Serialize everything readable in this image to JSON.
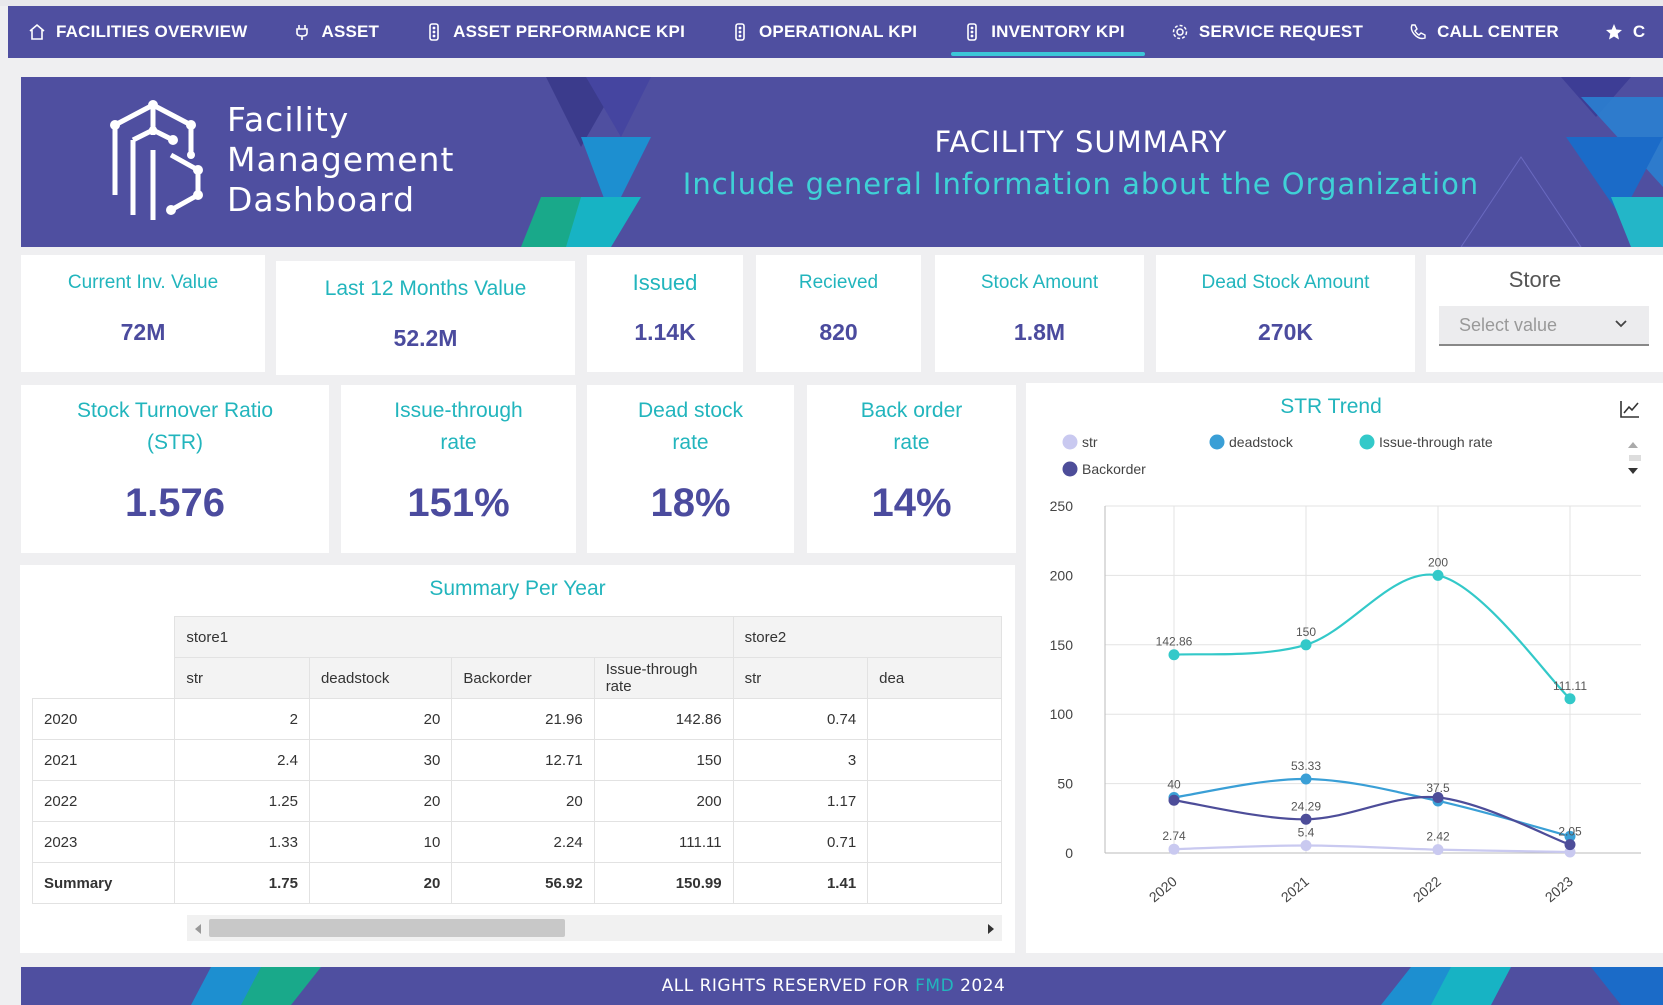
{
  "nav": {
    "items": [
      {
        "label": "FACILITIES OVERVIEW",
        "icon": "home-icon"
      },
      {
        "label": "ASSET",
        "icon": "plug-icon"
      },
      {
        "label": "ASSET PERFORMANCE KPI",
        "icon": "traffic-light-icon"
      },
      {
        "label": "OPERATIONAL KPI",
        "icon": "traffic-light-icon"
      },
      {
        "label": "INVENTORY KPI",
        "icon": "traffic-light-icon"
      },
      {
        "label": "SERVICE REQUEST",
        "icon": "gear-icon"
      },
      {
        "label": "CALL CENTER",
        "icon": "phone-icon"
      },
      {
        "label": "C",
        "icon": "star-icon"
      }
    ],
    "active": "INVENTORY KPI"
  },
  "banner": {
    "brand_line1": "Facility",
    "brand_line2": "Management",
    "brand_line3": "Dashboard",
    "title": "FACILITY SUMMARY",
    "subtitle": "Include general Information about the Organization"
  },
  "kpis": {
    "current_inv": {
      "label": "Current Inv. Value",
      "value": "72M"
    },
    "last12": {
      "label": "Last 12 Months Value",
      "value": "52.2M"
    },
    "issued": {
      "label": "Issued",
      "value": "1.14K"
    },
    "received": {
      "label": "Recieved",
      "value": "820"
    },
    "stock_amount": {
      "label": "Stock Amount",
      "value": "1.8M"
    },
    "dead_stock_amount": {
      "label": "Dead Stock Amount",
      "value": "270K"
    },
    "str": {
      "label_line1": "Stock Turnover Ratio",
      "label_line2": "(STR)",
      "value": "1.576"
    },
    "issue_through": {
      "label_line1": "Issue-through",
      "label_line2": "rate",
      "value": "151%"
    },
    "dead_stock_rate": {
      "label_line1": "Dead stock",
      "label_line2": "rate",
      "value": "18%"
    },
    "back_order": {
      "label_line1": "Back order",
      "label_line2": "rate",
      "value": "14%"
    }
  },
  "store_filter": {
    "label": "Store",
    "placeholder": "Select value"
  },
  "summary_table": {
    "title": "Summary Per Year",
    "groups": [
      "store1",
      "store2"
    ],
    "columns": [
      "str",
      "deadstock",
      "Backorder",
      "Issue-through rate",
      "str",
      "dea"
    ],
    "rows": [
      {
        "year": "2020",
        "cells": [
          "2",
          "20",
          "21.96",
          "142.86",
          "0.74"
        ]
      },
      {
        "year": "2021",
        "cells": [
          "2.4",
          "30",
          "12.71",
          "150",
          "3"
        ]
      },
      {
        "year": "2022",
        "cells": [
          "1.25",
          "20",
          "20",
          "200",
          "1.17"
        ]
      },
      {
        "year": "2023",
        "cells": [
          "1.33",
          "10",
          "2.24",
          "111.11",
          "0.71"
        ]
      }
    ],
    "summary_row": {
      "label": "Summary",
      "cells": [
        "1.75",
        "20",
        "56.92",
        "150.99",
        "1.41"
      ]
    }
  },
  "chart_data": {
    "type": "line",
    "title": "STR Trend",
    "categories": [
      "2020",
      "2021",
      "2022",
      "2023"
    ],
    "ylim": [
      0,
      250
    ],
    "yticks": [
      0,
      50,
      100,
      150,
      200,
      250
    ],
    "grid": true,
    "legend_position": "top-left",
    "series": [
      {
        "name": "str",
        "color": "#c9c9f0",
        "values": [
          2.74,
          5.4,
          2.42,
          0.71
        ],
        "labels": [
          "2.74",
          "5.4",
          "2.42",
          ""
        ]
      },
      {
        "name": "deadstock",
        "color": "#3a9fd6",
        "values": [
          40,
          53.33,
          37.5,
          12
        ],
        "labels": [
          "40",
          "53.33",
          "37.5",
          ""
        ]
      },
      {
        "name": "Issue-through rate",
        "color": "#33c9c9",
        "values": [
          142.86,
          150,
          200,
          111.11
        ],
        "labels": [
          "142.86",
          "150",
          "200",
          "111.11"
        ]
      },
      {
        "name": "Backorder",
        "color": "#4d4d99",
        "values": [
          38,
          24.29,
          40,
          6
        ],
        "labels": [
          "",
          "24.29",
          "",
          "2.05"
        ]
      }
    ]
  },
  "footer": {
    "text_before": "ALL RIGHTS RESERVED FOR",
    "brand": "FMD",
    "year": "2024"
  },
  "colors": {
    "primary": "#4f4fa0",
    "accent": "#22b5bd"
  }
}
